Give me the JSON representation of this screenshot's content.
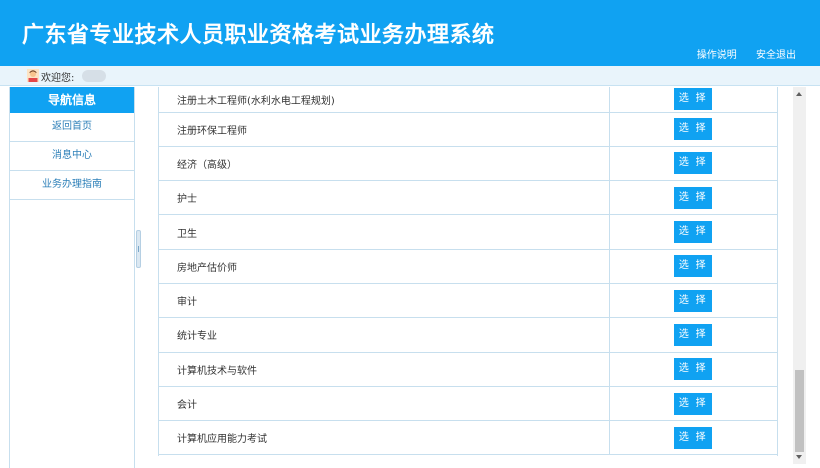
{
  "header": {
    "title": "广东省专业技术人员职业资格考试业务办理系统",
    "help_link": "操作说明",
    "logout_link": "安全退出"
  },
  "welcome": {
    "label": "欢迎您:"
  },
  "sidebar": {
    "header": "导航信息",
    "items": [
      {
        "label": "返回首页"
      },
      {
        "label": "消息中心"
      },
      {
        "label": "业务办理指南"
      }
    ]
  },
  "exam_list": {
    "select_label": "选 择",
    "rows": [
      {
        "name": "注册土木工程师(水利水电工程规划)"
      },
      {
        "name": "注册环保工程师"
      },
      {
        "name": "经济（高级）"
      },
      {
        "name": "护士"
      },
      {
        "name": "卫生"
      },
      {
        "name": "房地产估价师"
      },
      {
        "name": "审计"
      },
      {
        "name": "统计专业"
      },
      {
        "name": "计算机技术与软件"
      },
      {
        "name": "会计"
      },
      {
        "name": "计算机应用能力考试"
      }
    ]
  },
  "colors": {
    "primary": "#10a2f2",
    "border": "#c7dfee"
  }
}
